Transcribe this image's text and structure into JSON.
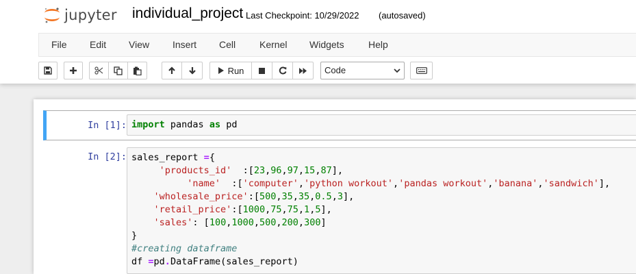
{
  "header": {
    "logo_text": "jupyter",
    "notebook_name": "individual_project",
    "checkpoint": "Last Checkpoint: 10/29/2022",
    "autosave_status": "(autosaved)"
  },
  "menu": {
    "items": [
      "File",
      "Edit",
      "View",
      "Insert",
      "Cell",
      "Kernel",
      "Widgets",
      "Help"
    ]
  },
  "toolbar": {
    "icons": [
      "save-icon",
      "plus-icon",
      "cut-icon",
      "copy-icon",
      "paste-icon",
      "arrow-up-icon",
      "arrow-down-icon",
      "play-icon",
      "stop-icon",
      "restart-icon",
      "fast-forward-icon",
      "keyboard-icon"
    ],
    "run_label": "Run",
    "cell_type": "Code"
  },
  "cells": [
    {
      "prompt": "In [1]:",
      "lines": [
        [
          [
            "kw",
            "import"
          ],
          [
            "",
            " pandas "
          ],
          [
            "kw",
            "as"
          ],
          [
            "",
            " pd"
          ]
        ]
      ]
    },
    {
      "prompt": "In [2]:",
      "lines": [
        [
          [
            "",
            "sales_report "
          ],
          [
            "op",
            "="
          ],
          [
            "",
            "{"
          ]
        ],
        [
          [
            "",
            "     "
          ],
          [
            "st",
            "'products_id'"
          ],
          [
            "",
            "  :["
          ],
          [
            "nu",
            "23"
          ],
          [
            "",
            ","
          ],
          [
            "nu",
            "96"
          ],
          [
            "",
            ","
          ],
          [
            "nu",
            "97"
          ],
          [
            "",
            ","
          ],
          [
            "nu",
            "15"
          ],
          [
            "",
            ","
          ],
          [
            "nu",
            "87"
          ],
          [
            "",
            "],"
          ]
        ],
        [
          [
            "",
            "          "
          ],
          [
            "st",
            "'name'"
          ],
          [
            "",
            "  :["
          ],
          [
            "st",
            "'computer'"
          ],
          [
            "",
            ","
          ],
          [
            "st",
            "'python workout'"
          ],
          [
            "",
            ","
          ],
          [
            "st",
            "'pandas workout'"
          ],
          [
            "",
            ","
          ],
          [
            "st",
            "'banana'"
          ],
          [
            "",
            ","
          ],
          [
            "st",
            "'sandwich'"
          ],
          [
            "",
            "],"
          ]
        ],
        [
          [
            "",
            "    "
          ],
          [
            "st",
            "'wholesale_price'"
          ],
          [
            "",
            ":["
          ],
          [
            "nu",
            "500"
          ],
          [
            "",
            ","
          ],
          [
            "nu",
            "35"
          ],
          [
            "",
            ","
          ],
          [
            "nu",
            "35"
          ],
          [
            "",
            ","
          ],
          [
            "nu",
            "0.5"
          ],
          [
            "",
            ","
          ],
          [
            "nu",
            "3"
          ],
          [
            "",
            "],"
          ]
        ],
        [
          [
            "",
            "    "
          ],
          [
            "st",
            "'retail_price'"
          ],
          [
            "",
            ":["
          ],
          [
            "nu",
            "1000"
          ],
          [
            "",
            ","
          ],
          [
            "nu",
            "75"
          ],
          [
            "",
            ","
          ],
          [
            "nu",
            "75"
          ],
          [
            "",
            ","
          ],
          [
            "nu",
            "1"
          ],
          [
            "",
            ","
          ],
          [
            "nu",
            "5"
          ],
          [
            "",
            "],"
          ]
        ],
        [
          [
            "",
            "    "
          ],
          [
            "st",
            "'sales'"
          ],
          [
            "",
            ": ["
          ],
          [
            "nu",
            "100"
          ],
          [
            "",
            ","
          ],
          [
            "nu",
            "1000"
          ],
          [
            "",
            ","
          ],
          [
            "nu",
            "500"
          ],
          [
            "",
            ","
          ],
          [
            "nu",
            "200"
          ],
          [
            "",
            ","
          ],
          [
            "nu",
            "300"
          ],
          [
            "",
            "]"
          ]
        ],
        [
          [
            "",
            "}"
          ]
        ],
        [
          [
            "cm",
            "#creating dataframe"
          ]
        ],
        [
          [
            "",
            "df "
          ],
          [
            "op",
            "="
          ],
          [
            "",
            "pd"
          ],
          [
            "op",
            "."
          ],
          [
            "",
            "DataFrame(sales_report)"
          ]
        ]
      ]
    }
  ]
}
